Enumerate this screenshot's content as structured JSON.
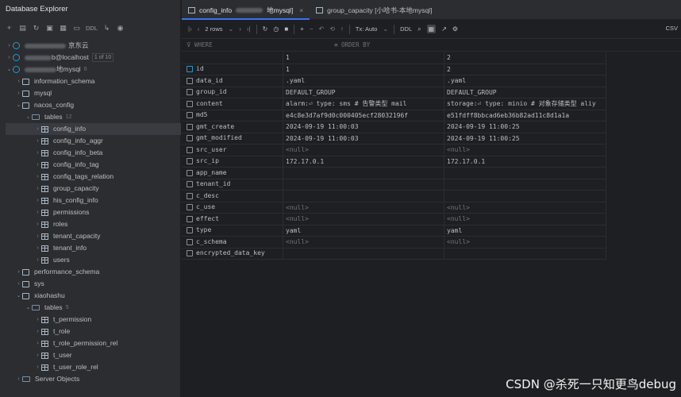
{
  "left": {
    "title": "Database Explorer",
    "toolbar": {
      "ddl": "DDL"
    },
    "tree": [
      {
        "label": "京东云",
        "tag": "",
        "cnt": ""
      },
      {
        "label": "b@localhost",
        "tag": "1 of 10",
        "cnt": ""
      },
      {
        "label": "地mysql",
        "tag": "",
        "cnt": "6"
      },
      {
        "label": "information_schema",
        "cnt": ""
      },
      {
        "label": "mysql",
        "cnt": ""
      },
      {
        "label": "nacos_config",
        "cnt": ""
      },
      {
        "label": "tables",
        "cnt": "12"
      },
      {
        "label": "config_info"
      },
      {
        "label": "config_info_aggr"
      },
      {
        "label": "config_info_beta"
      },
      {
        "label": "config_info_tag"
      },
      {
        "label": "config_tags_relation"
      },
      {
        "label": "group_capacity"
      },
      {
        "label": "his_config_info"
      },
      {
        "label": "permissions"
      },
      {
        "label": "roles"
      },
      {
        "label": "tenant_capacity"
      },
      {
        "label": "tenant_info"
      },
      {
        "label": "users"
      },
      {
        "label": "performance_schema"
      },
      {
        "label": "sys"
      },
      {
        "label": "xiaohashu"
      },
      {
        "label": "tables",
        "cnt": "5"
      },
      {
        "label": "t_permission"
      },
      {
        "label": "t_role"
      },
      {
        "label": "t_role_permission_rel"
      },
      {
        "label": "t_user"
      },
      {
        "label": "t_user_role_rel"
      },
      {
        "label": "Server Objects"
      }
    ]
  },
  "tabs": [
    {
      "label": "config_info",
      "suffix": "地mysql]"
    },
    {
      "label": "group_capacity [小哈书-本地mysql]"
    }
  ],
  "toolbar": {
    "rows": "2 rows",
    "tx": "Tx: Auto",
    "ddl": "DDL",
    "csv": "CSV"
  },
  "filter": {
    "where": "WHERE",
    "order": "ORDER BY"
  },
  "grid": {
    "head": [
      "1",
      "2"
    ],
    "rows": [
      {
        "field": "id",
        "v1": "1",
        "v2": "2"
      },
      {
        "field": "data_id",
        "v1": ".yaml",
        "v2": ".yaml"
      },
      {
        "field": "group_id",
        "v1": "DEFAULT_GROUP",
        "v2": "DEFAULT_GROUP"
      },
      {
        "field": "content",
        "v1": "alarm:⏎  type: sms # 告警类型 mail",
        "v2": "storage:⏎  type: minio # 对象存储类型 aliy"
      },
      {
        "field": "md5",
        "v1": "e4c8e3d7af9d0c000405ecf28032196f",
        "v2": "e51fdff8bbcad6eb36b82ad11c8d1a1a"
      },
      {
        "field": "gmt_create",
        "v1": "2024-09-19 11:00:03",
        "v2": "2024-09-19 11:00:25"
      },
      {
        "field": "gmt_modified",
        "v1": "2024-09-19 11:00:03",
        "v2": "2024-09-19 11:00:25"
      },
      {
        "field": "src_user",
        "v1": "<null>",
        "v2": "<null>"
      },
      {
        "field": "src_ip",
        "v1": "172.17.0.1",
        "v2": "172.17.0.1"
      },
      {
        "field": "app_name",
        "v1": "",
        "v2": ""
      },
      {
        "field": "tenant_id",
        "v1": "",
        "v2": ""
      },
      {
        "field": "c_desc",
        "v1": "",
        "v2": ""
      },
      {
        "field": "c_use",
        "v1": "<null>",
        "v2": "<null>"
      },
      {
        "field": "effect",
        "v1": "<null>",
        "v2": "<null>"
      },
      {
        "field": "type",
        "v1": "yaml",
        "v2": "yaml"
      },
      {
        "field": "c_schema",
        "v1": "<null>",
        "v2": "<null>"
      },
      {
        "field": "encrypted_data_key",
        "v1": "",
        "v2": ""
      }
    ]
  },
  "watermark": "CSDN @杀死一只知更鸟debug"
}
